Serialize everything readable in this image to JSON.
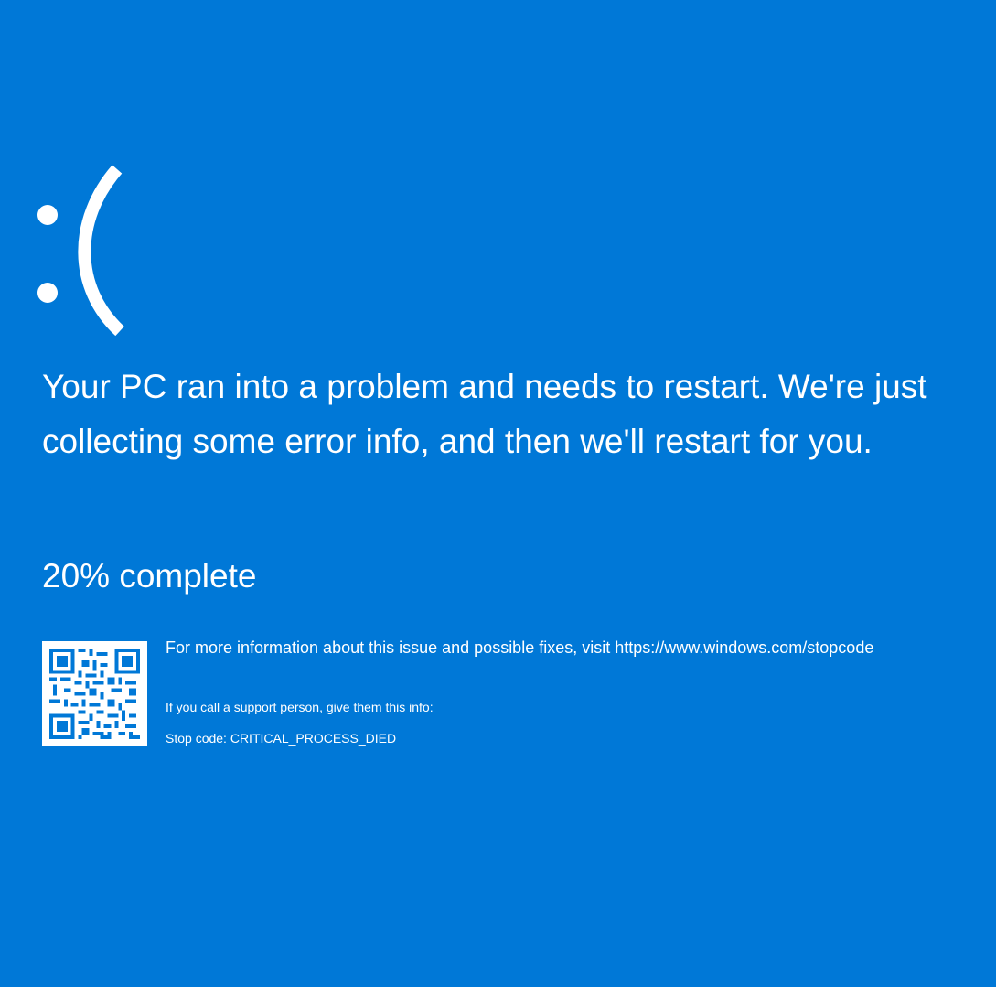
{
  "screen": {
    "background_color": "#0078d7",
    "text_color": "#ffffff",
    "emoticon": ":(",
    "message": "Your PC ran into a problem and needs to restart. We're just collecting some error info, and then we'll restart for you.",
    "progress_text": "20% complete",
    "progress_percent": 20,
    "more_info": "For more information about this issue and possible fixes, visit https://www.windows.com/stopcode",
    "support_info": "If you call a support person, give them this info:",
    "stop_code": "Stop code: CRITICAL_PROCESS_DIED",
    "qr_icon": "qr-code-icon"
  }
}
